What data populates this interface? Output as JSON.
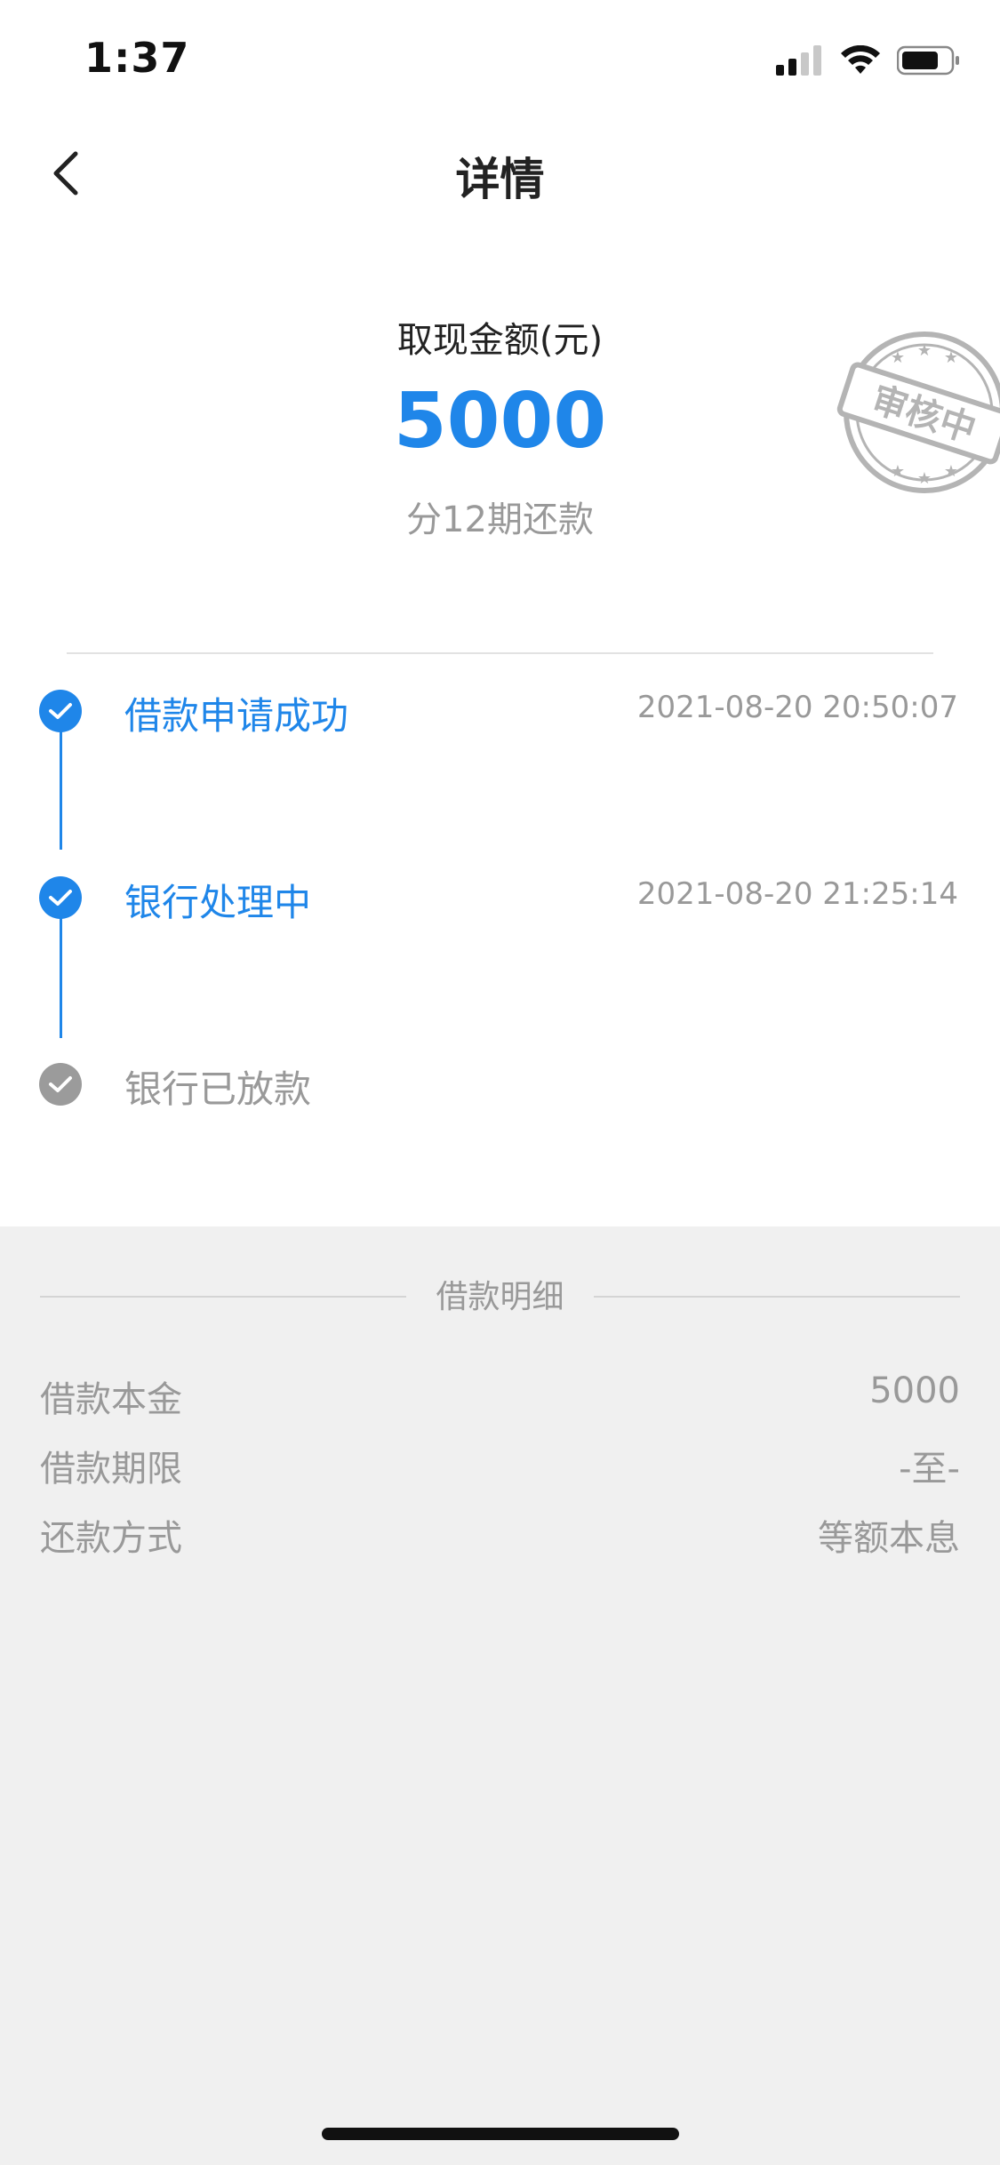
{
  "status_bar": {
    "time": "1:37"
  },
  "nav": {
    "title": "详情",
    "back_icon": "chevron-left-icon"
  },
  "summary": {
    "amount_label": "取现金额(元)",
    "amount_value": "5000",
    "installments_text": "分12期还款",
    "stamp_text": "审核中"
  },
  "timeline": {
    "steps": [
      {
        "label": "借款申请成功",
        "time": "2021-08-20 20:50:07",
        "state": "done"
      },
      {
        "label": "银行处理中",
        "time": "2021-08-20 21:25:14",
        "state": "done"
      },
      {
        "label": "银行已放款",
        "time": "",
        "state": "pending"
      }
    ]
  },
  "details": {
    "title": "借款明细",
    "rows": [
      {
        "label": "借款本金",
        "value": "5000"
      },
      {
        "label": "借款期限",
        "value": "-至-"
      },
      {
        "label": "还款方式",
        "value": "等额本息"
      }
    ]
  },
  "colors": {
    "accent": "#1f86e9",
    "muted": "#999999",
    "section_bg": "#f0f0f0"
  }
}
